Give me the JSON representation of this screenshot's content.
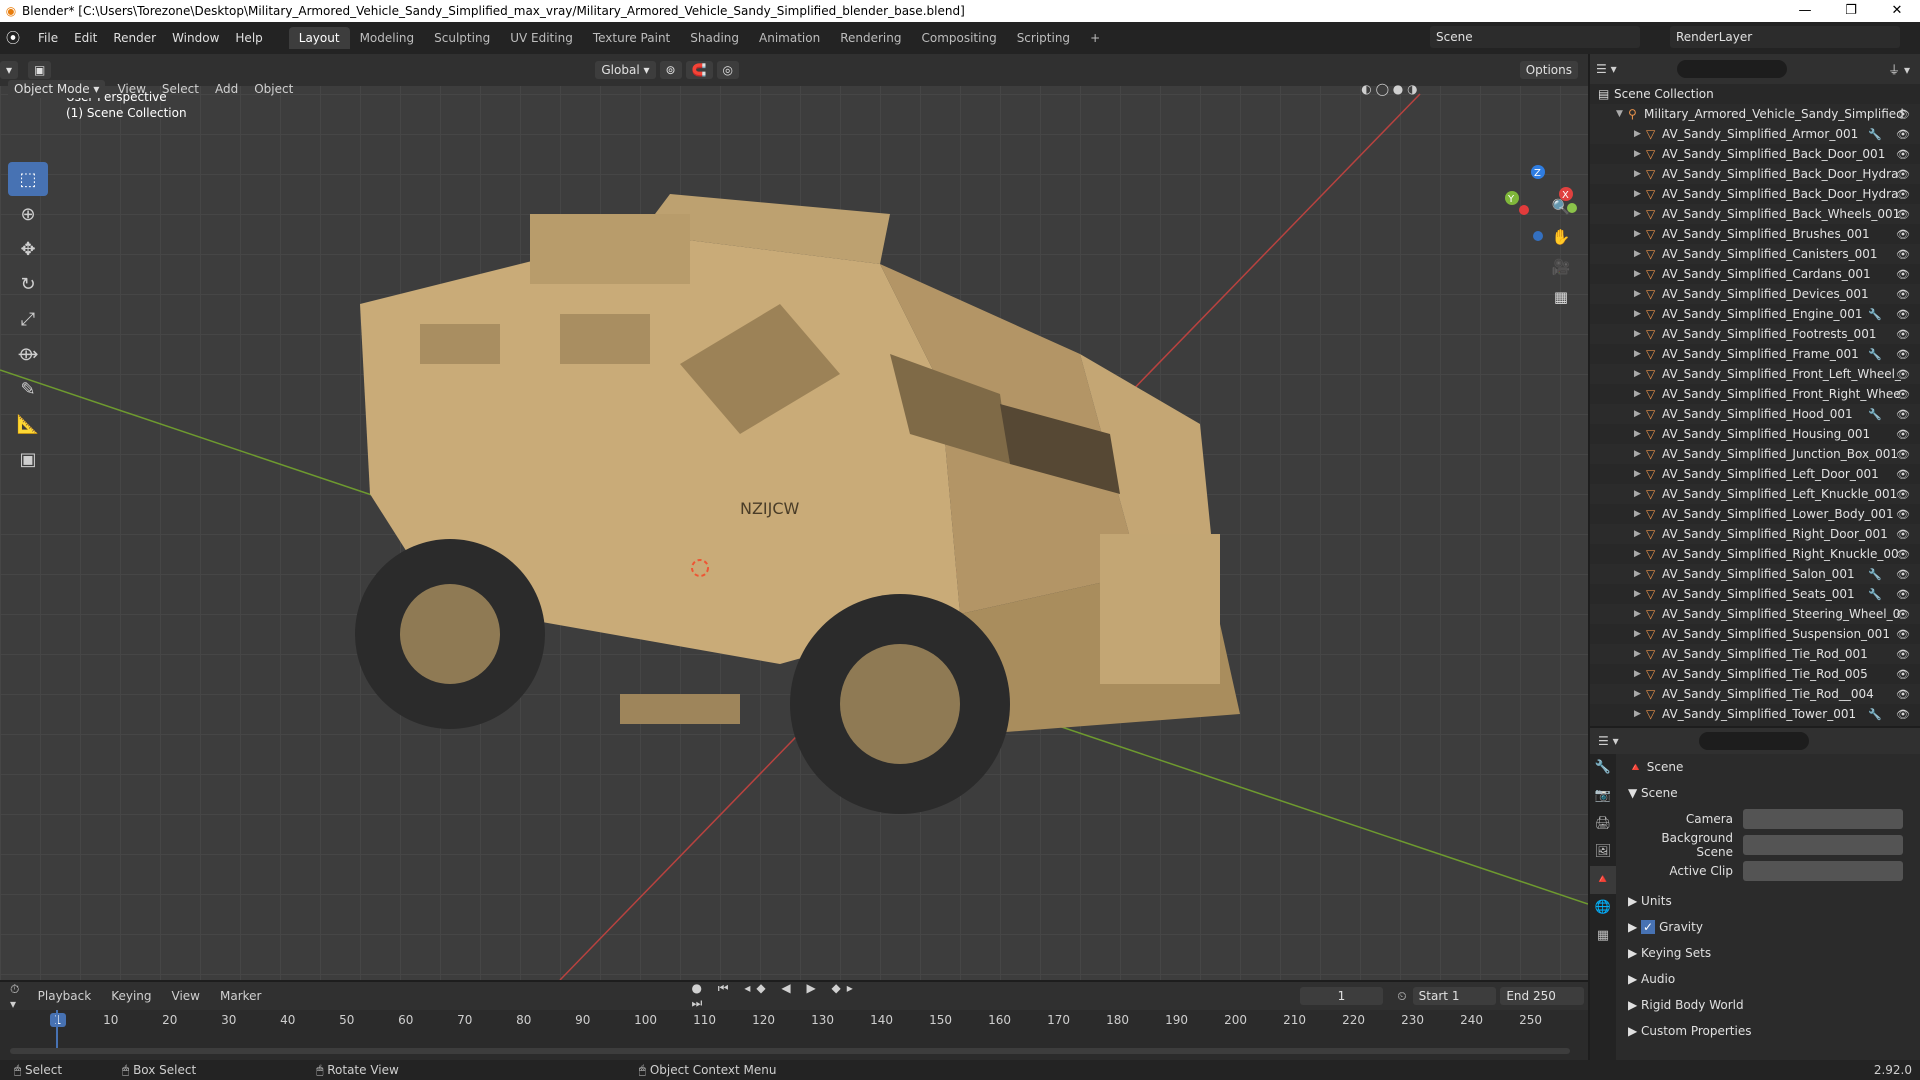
{
  "window": {
    "title": "Blender* [C:\\Users\\Torezone\\Desktop\\Military_Armored_Vehicle_Sandy_Simplified_max_vray/Military_Armored_Vehicle_Sandy_Simplified_blender_base.blend]"
  },
  "menu": [
    "File",
    "Edit",
    "Render",
    "Window",
    "Help"
  ],
  "workspaces": [
    "Layout",
    "Modeling",
    "Sculpting",
    "UV Editing",
    "Texture Paint",
    "Shading",
    "Animation",
    "Rendering",
    "Compositing",
    "Scripting"
  ],
  "active_workspace": "Layout",
  "scene_name": "Scene",
  "render_layer": "RenderLayer",
  "viewport": {
    "mode": "Object Mode",
    "menu": [
      "View",
      "Select",
      "Add",
      "Object"
    ],
    "orientation": "Global",
    "options": "Options",
    "perspective": "User Perspective",
    "collection": "(1) Scene Collection",
    "plate": "NZIJCW"
  },
  "outliner": {
    "root": "Scene Collection",
    "collection": "Military_Armored_Vehicle_Sandy_Simplified",
    "items": [
      "AV_Sandy_Simplified_Armor_001",
      "AV_Sandy_Simplified_Back_Door_001",
      "AV_Sandy_Simplified_Back_Door_Hydra",
      "AV_Sandy_Simplified_Back_Door_Hydra",
      "AV_Sandy_Simplified_Back_Wheels_001",
      "AV_Sandy_Simplified_Brushes_001",
      "AV_Sandy_Simplified_Canisters_001",
      "AV_Sandy_Simplified_Cardans_001",
      "AV_Sandy_Simplified_Devices_001",
      "AV_Sandy_Simplified_Engine_001",
      "AV_Sandy_Simplified_Footrests_001",
      "AV_Sandy_Simplified_Frame_001",
      "AV_Sandy_Simplified_Front_Left_Wheel_",
      "AV_Sandy_Simplified_Front_Right_Whee",
      "AV_Sandy_Simplified_Hood_001",
      "AV_Sandy_Simplified_Housing_001",
      "AV_Sandy_Simplified_Junction_Box_001",
      "AV_Sandy_Simplified_Left_Door_001",
      "AV_Sandy_Simplified_Left_Knuckle_001",
      "AV_Sandy_Simplified_Lower_Body_001",
      "AV_Sandy_Simplified_Right_Door_001",
      "AV_Sandy_Simplified_Right_Knuckle_00",
      "AV_Sandy_Simplified_Salon_001",
      "AV_Sandy_Simplified_Seats_001",
      "AV_Sandy_Simplified_Steering_Wheel_0",
      "AV_Sandy_Simplified_Suspension_001",
      "AV_Sandy_Simplified_Tie_Rod_001",
      "AV_Sandy_Simplified_Tie_Rod_005",
      "AV_Sandy_Simplified_Tie_Rod__004",
      "AV_Sandy_Simplified_Tower_001"
    ]
  },
  "properties": {
    "context": "Scene",
    "section": "Scene",
    "camera_label": "Camera",
    "bg_label": "Background Scene",
    "clip_label": "Active Clip",
    "panels": [
      "Units",
      "Gravity",
      "Keying Sets",
      "Audio",
      "Rigid Body World",
      "Custom Properties"
    ]
  },
  "timeline": {
    "menus": [
      "Playback",
      "Keying",
      "View",
      "Marker"
    ],
    "current": "1",
    "start_label": "Start",
    "start": "1",
    "end_label": "End",
    "end": "250",
    "ticks": [
      "1",
      "10",
      "20",
      "30",
      "40",
      "50",
      "60",
      "70",
      "80",
      "90",
      "100",
      "110",
      "120",
      "130",
      "140",
      "150",
      "160",
      "170",
      "180",
      "190",
      "200",
      "210",
      "220",
      "230",
      "240",
      "250"
    ]
  },
  "status": {
    "select": "Select",
    "box_select": "Box Select",
    "rotate": "Rotate View",
    "context": "Object Context Menu",
    "version": "2.92.0"
  }
}
